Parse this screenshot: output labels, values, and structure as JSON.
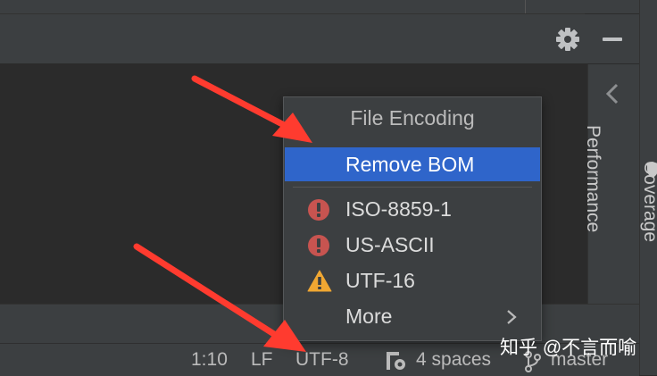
{
  "toolwindow": {
    "settings_icon": "gear-icon",
    "hide_icon": "minus-icon"
  },
  "side_bar": {
    "collapse_icon": "chevron-left-icon",
    "performance_label": "Performance",
    "coverage_label": "Coverage",
    "coverage_icon": "shield-icon"
  },
  "popup": {
    "title": "File Encoding",
    "items": [
      {
        "label": "Remove BOM",
        "selected": true
      },
      {
        "label": "ISO-8859-1",
        "icon": "error-icon"
      },
      {
        "label": "US-ASCII",
        "icon": "error-icon"
      },
      {
        "label": "UTF-16",
        "icon": "warning-icon"
      },
      {
        "label": "More",
        "icon": "chevron-right-icon"
      }
    ]
  },
  "status_bar": {
    "position": "1:10",
    "line_separator": "LF",
    "encoding": "UTF-8",
    "indent_icon": "indent-settings-icon",
    "indent": "4 spaces",
    "branch_icon": "git-branch-icon",
    "branch": "master"
  },
  "watermark": "知乎 @不言而喻",
  "colors": {
    "selection": "#2f65ca",
    "error": "#c75450",
    "warning": "#f0a732",
    "arrow": "#ff3b2f"
  }
}
